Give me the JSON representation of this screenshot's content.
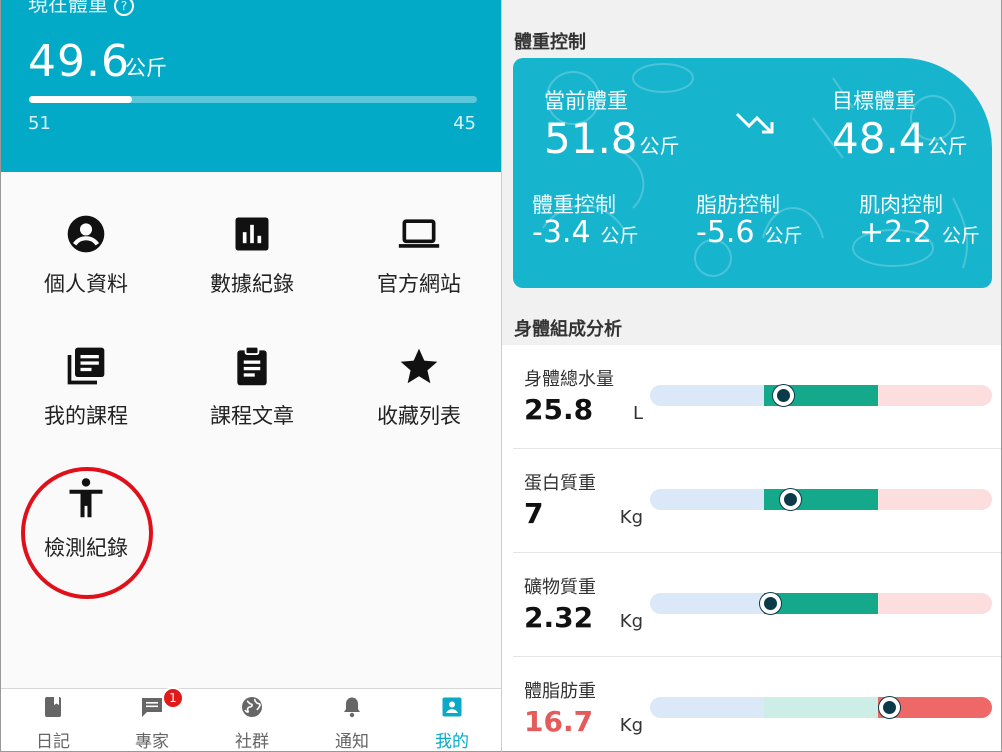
{
  "left": {
    "hero": {
      "current_label": "現在體重",
      "info_icon": "info-icon",
      "weight": "49.6",
      "weight_unit": "公斤",
      "progress": 0.23,
      "start": "51",
      "goal": "45",
      "bg_color": "#02aac7"
    },
    "menu": [
      {
        "label": "個人資料",
        "icon": "account-circle-icon"
      },
      {
        "label": "數據紀錄",
        "icon": "bar-chart-icon"
      },
      {
        "label": "官方網站",
        "icon": "laptop-icon"
      },
      {
        "label": "我的課程",
        "icon": "library-books-icon"
      },
      {
        "label": "課程文章",
        "icon": "clipboard-icon"
      },
      {
        "label": "收藏列表",
        "icon": "star-icon"
      },
      {
        "label": "檢測紀錄",
        "icon": "accessibility-icon"
      }
    ],
    "nav": [
      {
        "label": "日記",
        "icon": "book-icon"
      },
      {
        "label": "專家",
        "icon": "chat-icon",
        "badge": "1"
      },
      {
        "label": "社群",
        "icon": "globe-icon"
      },
      {
        "label": "通知",
        "icon": "bell-icon"
      },
      {
        "label": "我的",
        "icon": "profile-card-icon",
        "active": true
      }
    ],
    "highlight_color": "#e0101a"
  },
  "right": {
    "weight_control": {
      "title": "體重控制",
      "current_label": "當前體重",
      "current_value": "51.8",
      "target_label": "目標體重",
      "target_value": "48.4",
      "unit": "公斤",
      "trend_icon": "trending-down-icon",
      "stats": [
        {
          "label": "體重控制",
          "value": "-3.4",
          "unit": "公斤"
        },
        {
          "label": "脂肪控制",
          "value": "-5.6",
          "unit": "公斤"
        },
        {
          "label": "肌肉控制",
          "value": "+2.2",
          "unit": "公斤"
        }
      ],
      "card_color": "#17b4cd"
    },
    "body_composition": {
      "title": "身體組成分析",
      "rows": [
        {
          "name": "身體總水量",
          "value": "25.8",
          "unit": "L",
          "marker": 0.39,
          "alert": false
        },
        {
          "name": "蛋白質重",
          "value": "7",
          "unit": "Kg",
          "marker": 0.41,
          "alert": false
        },
        {
          "name": "礦物質重",
          "value": "2.32",
          "unit": "Kg",
          "marker": 0.35,
          "alert": false
        },
        {
          "name": "體脂肪重",
          "value": "16.7",
          "unit": "Kg",
          "marker": 0.7,
          "alert": true
        }
      ],
      "colors": {
        "low": "#dbe8f8",
        "normal": "#15a98c",
        "high": "#fcdede",
        "alert_value": "#e55a5a"
      }
    }
  }
}
